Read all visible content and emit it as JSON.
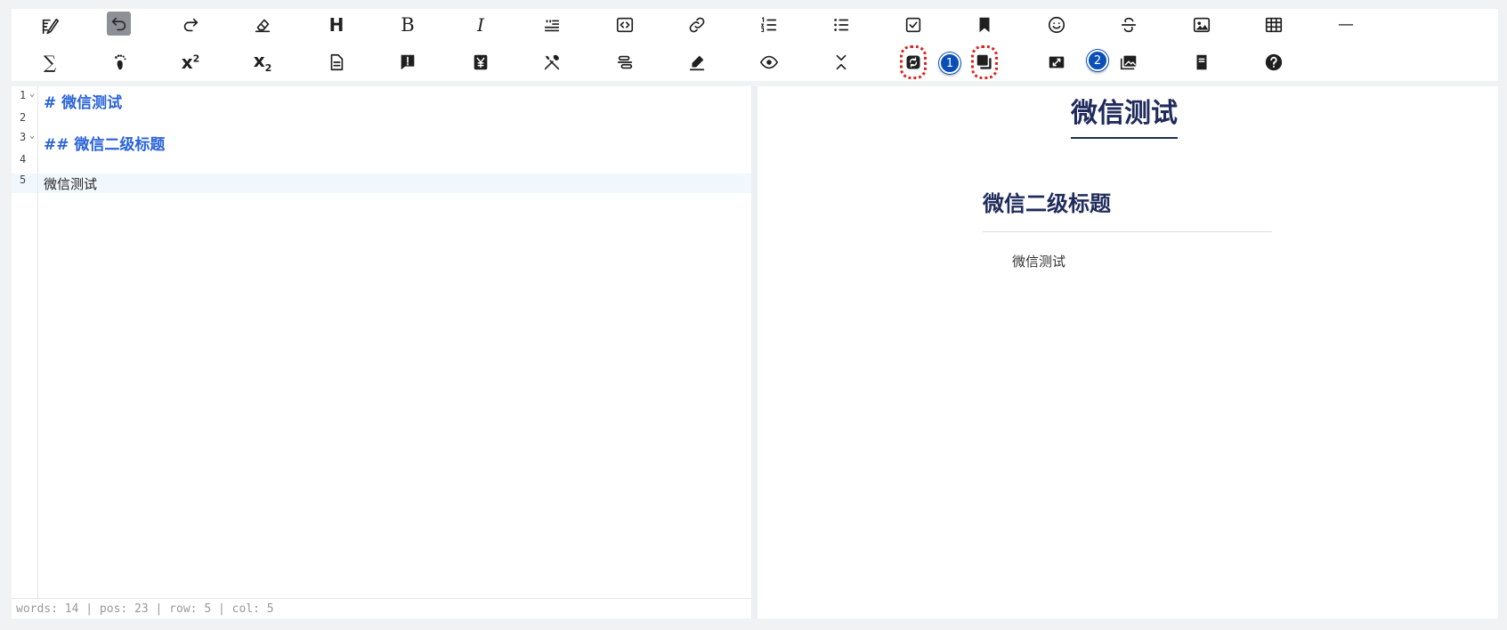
{
  "editor": {
    "lines": [
      {
        "num": "1",
        "text": "#  微信测试",
        "fold": "⌄"
      },
      {
        "num": "2",
        "text": ""
      },
      {
        "num": "3",
        "text": "##  微信二级标题",
        "fold": "⌄"
      },
      {
        "num": "4",
        "text": ""
      },
      {
        "num": "5",
        "text": "微信测试"
      }
    ],
    "status": "words: 14 | pos: 23 | row: 5 | col: 5"
  },
  "preview": {
    "h1": "微信测试",
    "h2": "微信二级标题",
    "p": "微信测试"
  },
  "toolbar": {
    "heading_glyph": "H",
    "bold_glyph": "B",
    "italic_glyph": "I",
    "sup_base": "x",
    "sup_exp": "2",
    "sub_base": "x",
    "sub_exp": "2",
    "sum_glyph": "∑",
    "hr_glyph": "—",
    "collapse_glyph": "⌃⌄"
  },
  "badges": {
    "one": "1",
    "two": "2"
  },
  "colors": {
    "heading_blue": "#2a63d9",
    "preview_navy": "#1f2b5c",
    "highlight_red": "#e0211d",
    "badge_blue": "#0a4fb8",
    "active_gray": "#8d9096"
  }
}
